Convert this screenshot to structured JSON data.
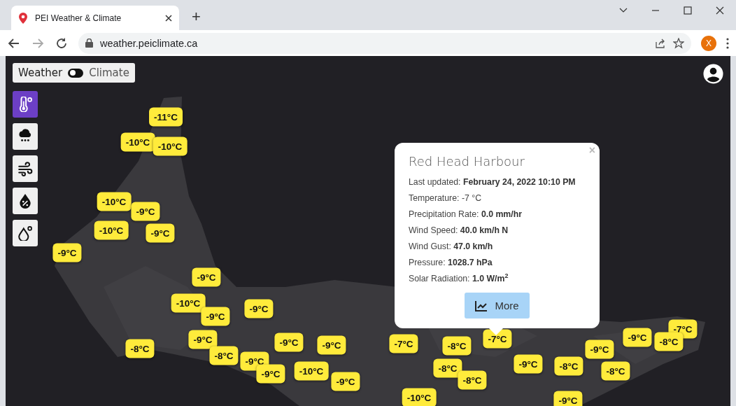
{
  "browser": {
    "tab_title": "PEI Weather & Climate",
    "new_tab": "+",
    "url": "weather.peiclimate.ca",
    "profile": "X"
  },
  "mode_toggle": {
    "left_label": "Weather",
    "right_label": "Climate",
    "on": false
  },
  "layers": [
    {
      "kind": "temperature",
      "selected": true
    },
    {
      "kind": "precipitation",
      "selected": false
    },
    {
      "kind": "wind",
      "selected": false
    },
    {
      "kind": "humidity",
      "selected": false
    },
    {
      "kind": "dewpoint",
      "selected": false
    }
  ],
  "markers": [
    {
      "label": "-11°C"
    },
    {
      "label": "-10°C"
    },
    {
      "label": "-10°C"
    },
    {
      "label": "-10°C"
    },
    {
      "label": "-9°C"
    },
    {
      "label": "-10°C"
    },
    {
      "label": "-9°C"
    },
    {
      "label": "-9°C"
    },
    {
      "label": "-9°C"
    },
    {
      "label": "-10°C"
    },
    {
      "label": "-9°C"
    },
    {
      "label": "-9°C"
    },
    {
      "label": "-8°C"
    },
    {
      "label": "-9°C"
    },
    {
      "label": "-8°C"
    },
    {
      "label": "-9°C"
    },
    {
      "label": "-9°C"
    },
    {
      "label": "-7°C"
    },
    {
      "label": "-8°C"
    },
    {
      "label": "-7°C"
    },
    {
      "label": "-8°C"
    },
    {
      "label": "-8°C"
    },
    {
      "label": "-9°C"
    },
    {
      "label": "-8°C"
    },
    {
      "label": "-9°C"
    },
    {
      "label": "-8°C"
    },
    {
      "label": "-9°C"
    },
    {
      "label": "-7°C"
    },
    {
      "label": "-8°C"
    },
    {
      "label": "-9°C"
    },
    {
      "label": "-9°C"
    },
    {
      "label": "-10°C"
    },
    {
      "label": "-9°C"
    },
    {
      "label": "-9°C"
    },
    {
      "label": "-10°C"
    }
  ],
  "popup": {
    "close": "×",
    "title": "Red Head Harbour",
    "lines": [
      {
        "label": "Last updated:",
        "value": "February 24, 2022 10:10 PM"
      },
      {
        "label": "Temperature:",
        "value": "-7 °C"
      },
      {
        "label": "Precipitation Rate:",
        "value": "**0.0 mm/hr**"
      },
      {
        "label": "Wind Speed:",
        "value": "**40.0 km/h N**"
      },
      {
        "label": "Wind Gust:",
        "value": "**47.0 km/h**"
      },
      {
        "label": "Pressure:",
        "value": "**1028.7 hPa**"
      },
      {
        "label": "Solar Radiation:",
        "value": "**1.0 W/m$^{2}$**"
      }
    ],
    "button": "More"
  }
}
